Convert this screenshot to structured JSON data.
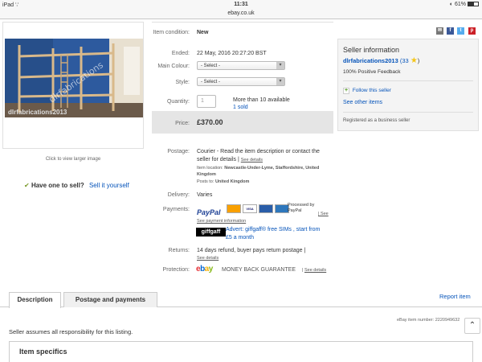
{
  "statusbar": {
    "device": "iPad",
    "wifi_icon": "wifi-icon",
    "time": "11:31",
    "battery": "61%",
    "battery_level": 0.61
  },
  "urlbar": {
    "domain": "ebay.co.uk"
  },
  "gallery": {
    "watermark": "dlrfabrications2013",
    "view_larger": "Click to view larger image"
  },
  "sell_promo": {
    "text": "Have one to sell?",
    "link": "Sell it yourself"
  },
  "item": {
    "condition_label": "Item condition:",
    "condition": "New",
    "ended_label": "Ended:",
    "ended": "22 May, 2016  20:27:20 BST",
    "colour_label": "Main Colour:",
    "colour_value": "- Select -",
    "style_label": "Style:",
    "style_value": "- Select -",
    "quantity_label": "Quantity:",
    "quantity_value": "1",
    "available": "More than 10 available",
    "sold": "1 sold",
    "price_label": "Price:",
    "price": "£370.00"
  },
  "postage": {
    "label": "Postage:",
    "text_1": "Courier - Read the item description or contact the",
    "text_2": "seller for details |",
    "see_details": "See details",
    "location_label": "Item location:",
    "location": "Newcastle-Under-Lyme, Staffordshire, United Kingdom",
    "posts_label": "Posts to:",
    "posts_to": "United Kingdom"
  },
  "delivery": {
    "label": "Delivery:",
    "value": "Varies"
  },
  "payments": {
    "label": "Payments:",
    "paypal": "PayPal",
    "cards": [
      "",
      "VISA",
      "",
      ""
    ],
    "processed": "Processed by PayPal",
    "see_payment": "See payment information",
    "giffgaff": "giffgaff",
    "advert_1": "Advert: giffgaff® free SIMs , start from",
    "advert_2": "£5 a month"
  },
  "returns": {
    "label": "Returns:",
    "text": "14 days refund, buyer pays return postage |",
    "see_details": "See details"
  },
  "protection": {
    "label": "Protection:",
    "logo": "ebay",
    "guarantee": "MONEY BACK GUARANTEE",
    "see_details": "See details"
  },
  "seller": {
    "title": "Seller information",
    "name": "dlrfabrications2013",
    "score": "33",
    "feedback": "100% Positive Feedback",
    "follow": "Follow this seller",
    "other_items": "See other items",
    "business": "Registered as a business seller"
  },
  "tabs": [
    {
      "label": "Description"
    },
    {
      "label": "Postage and payments"
    }
  ],
  "report_item": "Report item",
  "item_number_label": "eBay item number:",
  "item_number": "2220949632",
  "responsibility": "Seller assumes all responsibility for this listing.",
  "specifics_title": "Item specifics",
  "colors": {
    "link": "#0654ba",
    "price_bg": "#e5e5e5",
    "star": "#f5c518",
    "facebook": "#3b5998",
    "twitter": "#55acee",
    "pinterest": "#cb2027",
    "email": "#777777"
  }
}
